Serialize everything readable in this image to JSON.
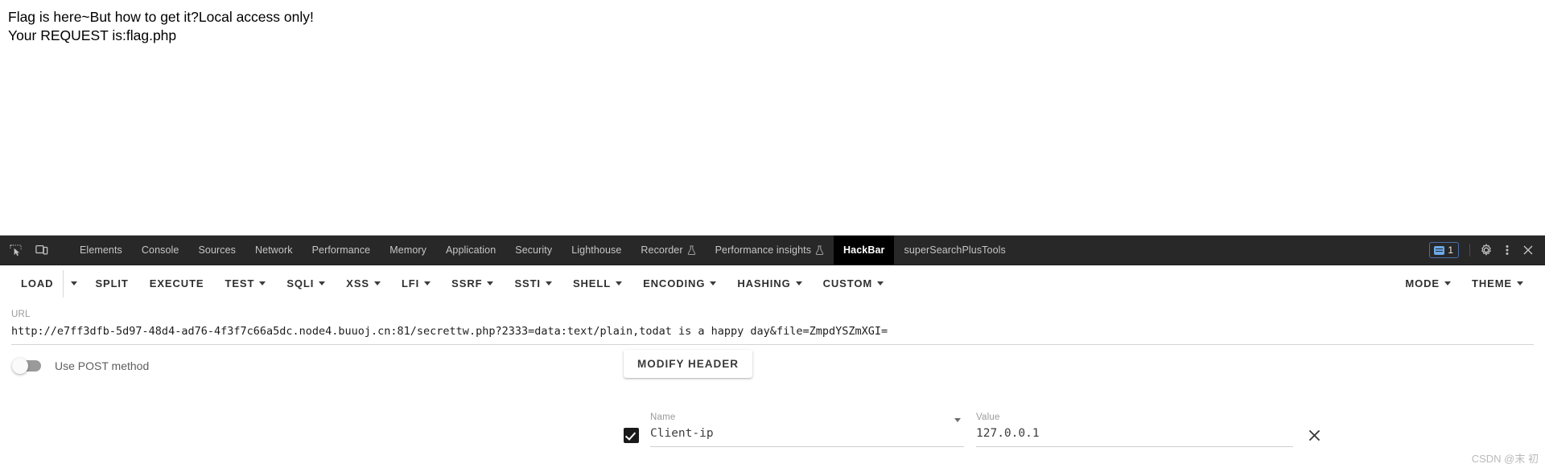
{
  "page": {
    "lines": [
      "Flag is here~But how to get it?Local access only!",
      "Your REQUEST is:flag.php"
    ]
  },
  "devtools": {
    "icons": {
      "inspect": "inspect-element-icon",
      "device": "device-toolbar-icon"
    },
    "tabs": [
      {
        "label": "Elements",
        "selected": false,
        "flask": false
      },
      {
        "label": "Console",
        "selected": false,
        "flask": false
      },
      {
        "label": "Sources",
        "selected": false,
        "flask": false
      },
      {
        "label": "Network",
        "selected": false,
        "flask": false
      },
      {
        "label": "Performance",
        "selected": false,
        "flask": false
      },
      {
        "label": "Memory",
        "selected": false,
        "flask": false
      },
      {
        "label": "Application",
        "selected": false,
        "flask": false
      },
      {
        "label": "Security",
        "selected": false,
        "flask": false
      },
      {
        "label": "Lighthouse",
        "selected": false,
        "flask": false
      },
      {
        "label": "Recorder",
        "selected": false,
        "flask": true
      },
      {
        "label": "Performance insights",
        "selected": false,
        "flask": true
      },
      {
        "label": "HackBar",
        "selected": true,
        "flask": false
      },
      {
        "label": "superSearchPlusTools",
        "selected": false,
        "flask": false
      }
    ],
    "status": {
      "message_count": "1",
      "settings_icon": "gear-icon",
      "more_icon": "kebab-menu-icon",
      "close_icon": "close-icon"
    },
    "colors": {
      "tabbar_bg": "#282828",
      "selected_tab_bg": "#000000",
      "badge_border": "#4b6ea8"
    }
  },
  "hackbar": {
    "toolbar": [
      {
        "label": "LOAD",
        "dropdown": false,
        "split": true
      },
      {
        "label": "SPLIT",
        "dropdown": false,
        "split": false
      },
      {
        "label": "EXECUTE",
        "dropdown": false,
        "split": false
      },
      {
        "label": "TEST",
        "dropdown": true,
        "split": false
      },
      {
        "label": "SQLI",
        "dropdown": true,
        "split": false
      },
      {
        "label": "XSS",
        "dropdown": true,
        "split": false
      },
      {
        "label": "LFI",
        "dropdown": true,
        "split": false
      },
      {
        "label": "SSRF",
        "dropdown": true,
        "split": false
      },
      {
        "label": "SSTI",
        "dropdown": true,
        "split": false
      },
      {
        "label": "SHELL",
        "dropdown": true,
        "split": false
      },
      {
        "label": "ENCODING",
        "dropdown": true,
        "split": false
      },
      {
        "label": "HASHING",
        "dropdown": true,
        "split": false
      },
      {
        "label": "CUSTOM",
        "dropdown": true,
        "split": false
      }
    ],
    "toolbar_right": [
      {
        "label": "MODE",
        "dropdown": true
      },
      {
        "label": "THEME",
        "dropdown": true
      }
    ],
    "url": {
      "label": "URL",
      "value": "http://e7ff3dfb-5d97-48d4-ad76-4f3f7c66a5dc.node4.buuoj.cn:81/secrettw.php?2333=data:text/plain,todat is a happy day&file=ZmpdYSZmXGI="
    },
    "post_toggle": {
      "label": "Use POST method",
      "checked": false
    },
    "modify_header_label": "MODIFY HEADER",
    "header_row": {
      "enabled": true,
      "name_label": "Name",
      "name_value": "Client-ip",
      "value_label": "Value",
      "value_value": "127.0.0.1"
    }
  },
  "watermark": "CSDN @末 初"
}
